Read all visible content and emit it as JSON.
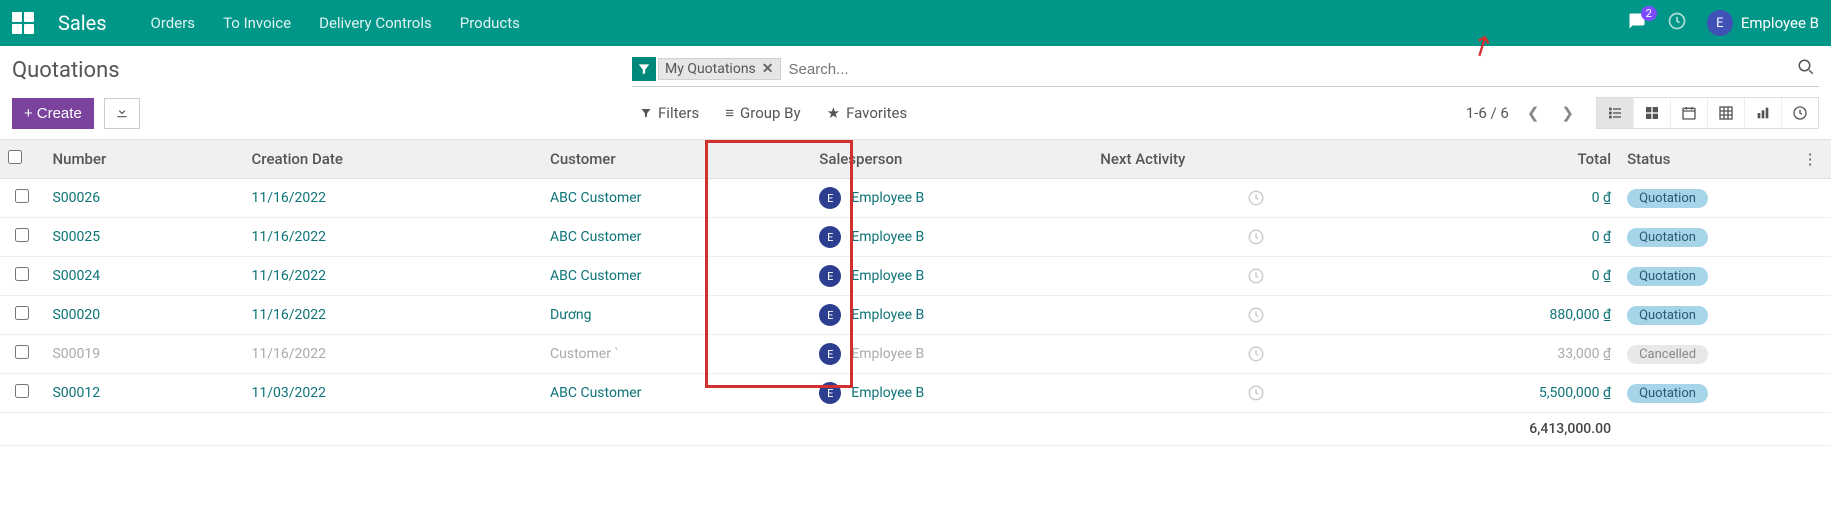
{
  "nav": {
    "app": "Sales",
    "menu": [
      "Orders",
      "To Invoice",
      "Delivery Controls",
      "Products"
    ],
    "chat_count": "2",
    "user_initial": "E",
    "user_name": "Employee B"
  },
  "cp": {
    "breadcrumb": "Quotations",
    "facet_label": "My Quotations",
    "search_placeholder": "Search...",
    "create": "Create",
    "filters": "Filters",
    "groupby": "Group By",
    "favorites": "Favorites",
    "pager": "1-6 / 6"
  },
  "headers": {
    "number": "Number",
    "date": "Creation Date",
    "customer": "Customer",
    "salesperson": "Salesperson",
    "activity": "Next Activity",
    "total": "Total",
    "status": "Status"
  },
  "rows": [
    {
      "num": "S00026",
      "date": "11/16/2022",
      "cust": "ABC Customer",
      "sp": "Employee B",
      "sp_i": "E",
      "total": "0 ₫",
      "status": "Quotation",
      "state": "q"
    },
    {
      "num": "S00025",
      "date": "11/16/2022",
      "cust": "ABC Customer",
      "sp": "Employee B",
      "sp_i": "E",
      "total": "0 ₫",
      "status": "Quotation",
      "state": "q"
    },
    {
      "num": "S00024",
      "date": "11/16/2022",
      "cust": "ABC Customer",
      "sp": "Employee B",
      "sp_i": "E",
      "total": "0 ₫",
      "status": "Quotation",
      "state": "q"
    },
    {
      "num": "S00020",
      "date": "11/16/2022",
      "cust": "Dương",
      "sp": "Employee B",
      "sp_i": "E",
      "total": "880,000 ₫",
      "status": "Quotation",
      "state": "q"
    },
    {
      "num": "S00019",
      "date": "11/16/2022",
      "cust": "Customer `",
      "sp": "Employee B",
      "sp_i": "E",
      "total": "33,000 ₫",
      "status": "Cancelled",
      "state": "c"
    },
    {
      "num": "S00012",
      "date": "11/03/2022",
      "cust": "ABC Customer",
      "sp": "Employee B",
      "sp_i": "E",
      "total": "5,500,000 ₫",
      "status": "Quotation",
      "state": "q"
    }
  ],
  "footer_total": "6,413,000.00"
}
